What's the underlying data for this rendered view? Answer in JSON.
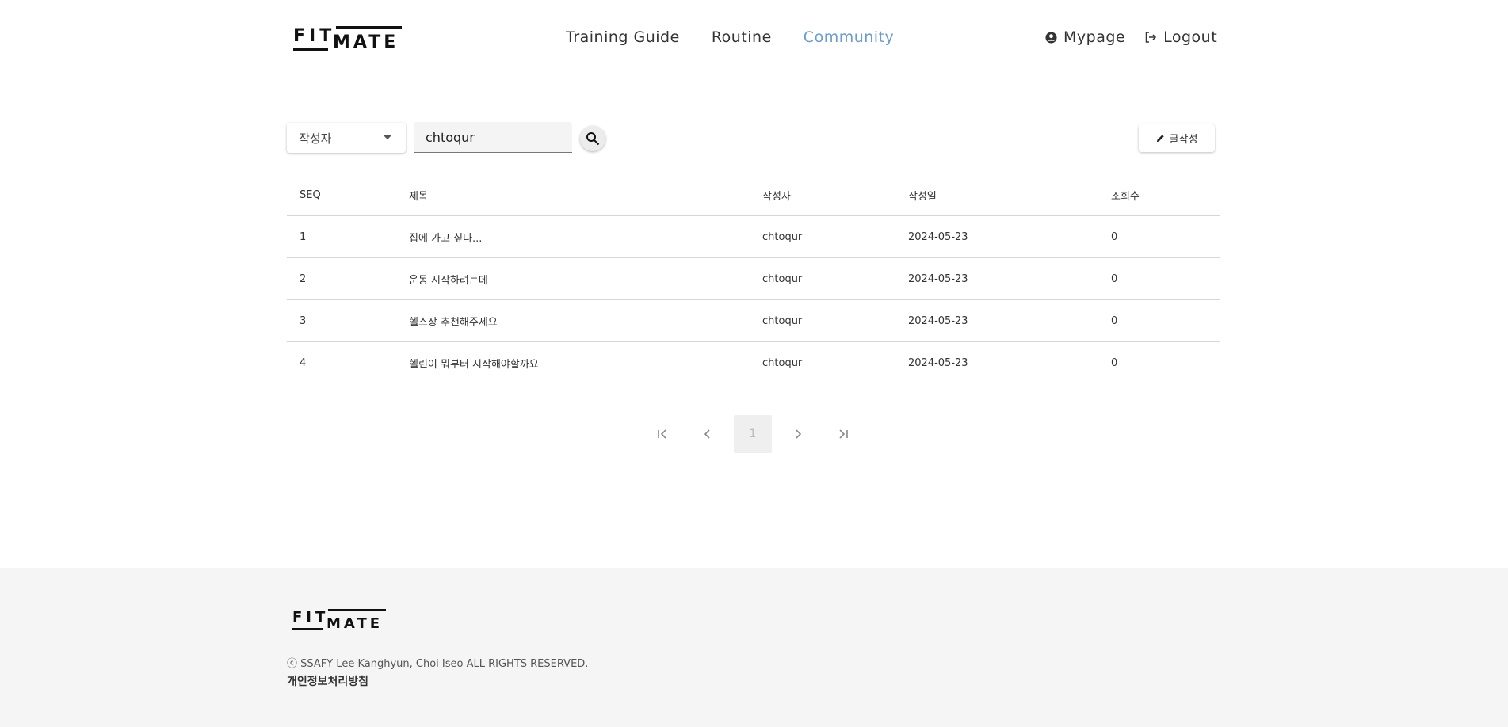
{
  "header": {
    "logo": {
      "line1": "FIT",
      "line2": "MATE"
    },
    "nav": [
      {
        "label": "Training Guide",
        "active": false
      },
      {
        "label": "Routine",
        "active": false
      },
      {
        "label": "Community",
        "active": true
      }
    ],
    "mypage_label": "Mypage",
    "logout_label": "Logout",
    "accent_color": "#6b9cd4"
  },
  "search": {
    "filter_selected": "작성자",
    "query_value": "chtoqur",
    "write_label": "글작성"
  },
  "table": {
    "columns": [
      "SEQ",
      "제목",
      "작성자",
      "작성일",
      "조회수"
    ],
    "rows": [
      {
        "seq": "1",
        "title": "집에 가고 싶다...",
        "author": "chtoqur",
        "date": "2024-05-23",
        "views": "0"
      },
      {
        "seq": "2",
        "title": "운동 시작하려는데",
        "author": "chtoqur",
        "date": "2024-05-23",
        "views": "0"
      },
      {
        "seq": "3",
        "title": "헬스장 추천해주세요",
        "author": "chtoqur",
        "date": "2024-05-23",
        "views": "0"
      },
      {
        "seq": "4",
        "title": "헬린이 뭐부터 시작해야할까요",
        "author": "chtoqur",
        "date": "2024-05-23",
        "views": "0"
      }
    ]
  },
  "pagination": {
    "current_page": "1"
  },
  "footer": {
    "logo": {
      "line1": "FIT",
      "line2": "MATE"
    },
    "copyright": "ⓒ SSAFY Lee Kanghyun, Choi Iseo ALL RIGHTS RESERVED.",
    "privacy": "개인정보처리방침"
  }
}
